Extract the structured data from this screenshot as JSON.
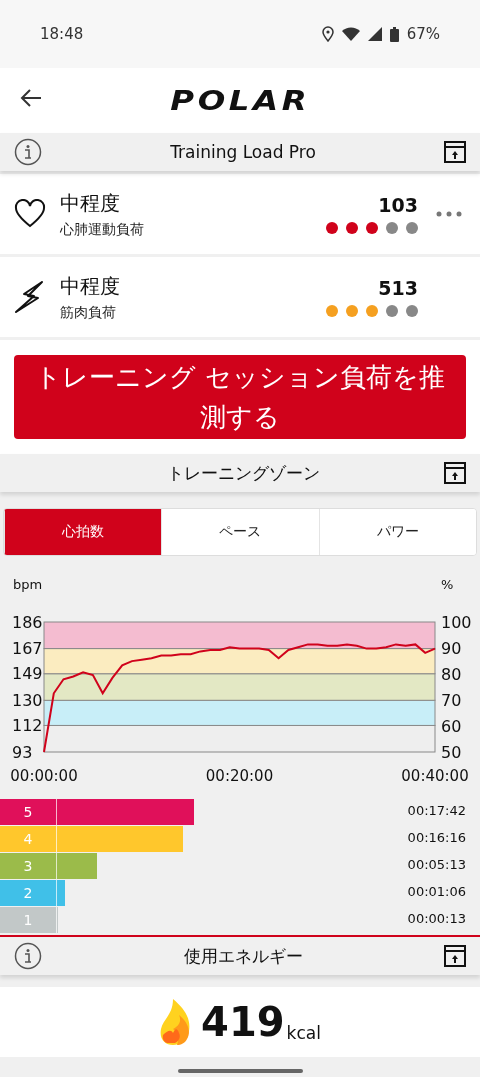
{
  "status_bar": {
    "time": "18:48",
    "battery": "67%"
  },
  "header": {
    "logo": "POLAR"
  },
  "training_load": {
    "title": "Training Load Pro",
    "info": true,
    "rows": [
      {
        "kind": "heart",
        "level_text": "中程度",
        "label": "心肺運動負荷",
        "value": "103",
        "stars": 3,
        "color": "#d0021b",
        "more": true
      },
      {
        "kind": "bolt",
        "level_text": "中程度",
        "label": "筋肉負荷",
        "value": "513",
        "stars": 3,
        "color": "#f5a020",
        "more": false
      }
    ],
    "button": "トレーニング セッション負荷を推測する"
  },
  "zones": {
    "title": "トレーニングゾーン",
    "info": false,
    "tabs": [
      {
        "label": "心拍数",
        "selected": true
      },
      {
        "label": "ペース",
        "selected": false
      },
      {
        "label": "パワー",
        "selected": false
      }
    ],
    "right_unit": "%",
    "right_ticks": [
      "100",
      "90",
      "80",
      "70",
      "60",
      "50"
    ],
    "chart_data": {
      "type": "line",
      "ylabel": "bpm",
      "x": [
        0,
        1,
        2,
        3,
        4,
        5,
        6,
        7,
        8,
        9,
        10,
        11,
        12,
        13,
        14,
        15,
        16,
        17,
        18,
        19,
        20,
        21,
        22,
        23,
        24,
        25,
        26,
        27,
        28,
        29,
        30,
        31,
        32,
        33,
        34,
        35,
        36,
        37,
        38,
        39,
        40
      ],
      "xlim": [
        0,
        40
      ],
      "ylim": [
        93,
        186
      ],
      "xticks": [
        {
          "value": 0,
          "label": "00:00:00"
        },
        {
          "value": 20,
          "label": "00:20:00"
        },
        {
          "value": 40,
          "label": "00:40:00"
        }
      ],
      "yticks": [
        93,
        112,
        130,
        149,
        167,
        186
      ],
      "series": [
        {
          "color": "#d0021b",
          "values": [
            93,
            135,
            145,
            147,
            150,
            148,
            135,
            146,
            155,
            158,
            159,
            160,
            162,
            162,
            163,
            163,
            165,
            166,
            166,
            168,
            167,
            167,
            167,
            166,
            160,
            166,
            168,
            170,
            170,
            169,
            169,
            170,
            169,
            167,
            167,
            168,
            170,
            169,
            170,
            164,
            167
          ]
        }
      ]
    },
    "bars": [
      {
        "label": "5",
        "time": "00:17:42",
        "color": "#e0105a"
      },
      {
        "label": "4",
        "time": "00:16:16",
        "color": "#ffc72c"
      },
      {
        "label": "3",
        "time": "00:05:13",
        "color": "#9bbb4a"
      },
      {
        "label": "2",
        "time": "00:01:06",
        "color": "#40c0e8"
      },
      {
        "label": "1",
        "time": "00:00:13",
        "color": "#c2c8c8"
      }
    ]
  },
  "energy": {
    "title": "使用エネルギー",
    "info": true,
    "value": "419",
    "unit": "kcal"
  }
}
